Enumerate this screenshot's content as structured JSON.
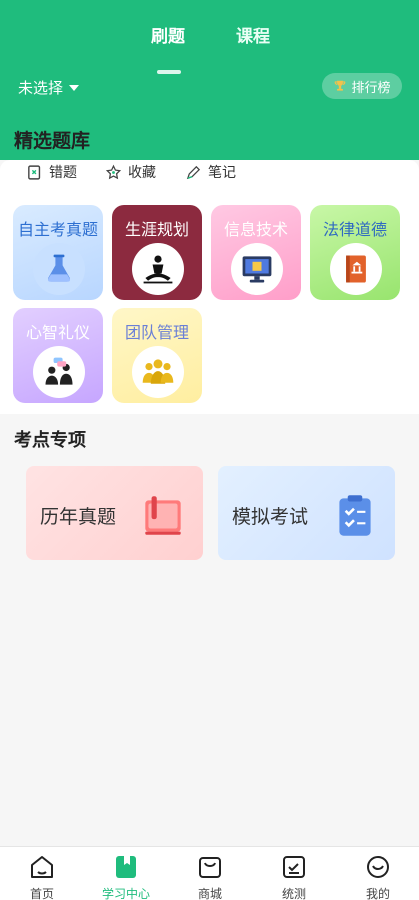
{
  "header": {
    "tabs": [
      {
        "label": "刷题",
        "active": true
      },
      {
        "label": "课程",
        "active": false
      }
    ],
    "selector_label": "未选择",
    "rank_button": "排行榜",
    "accent_color": "#1fbc7d"
  },
  "featured": {
    "title": "精选题库",
    "actions": [
      {
        "label": "错题",
        "icon": "wrong-book-icon"
      },
      {
        "label": "收藏",
        "icon": "star-icon"
      },
      {
        "label": "笔记",
        "icon": "pen-icon"
      }
    ],
    "cards": [
      {
        "label": "自主考真题",
        "icon": "flask-icon"
      },
      {
        "label": "生涯规划",
        "icon": "meditation-icon"
      },
      {
        "label": "信息技术",
        "icon": "monitor-icon"
      },
      {
        "label": "法律道德",
        "icon": "law-book-icon"
      },
      {
        "label": "心智礼仪",
        "icon": "people-chat-icon"
      },
      {
        "label": "团队管理",
        "icon": "team-icon"
      }
    ]
  },
  "topics": {
    "title": "考点专项",
    "items": [
      {
        "label": "历年真题",
        "icon": "book-flag-icon"
      },
      {
        "label": "模拟考试",
        "icon": "clipboard-check-icon"
      }
    ]
  },
  "bottom_nav": [
    {
      "label": "首页",
      "icon": "home-icon",
      "active": false
    },
    {
      "label": "学习中心",
      "icon": "bookmark-book-icon",
      "active": true
    },
    {
      "label": "商城",
      "icon": "shopping-bag-icon",
      "active": false
    },
    {
      "label": "统测",
      "icon": "checklist-icon",
      "active": false
    },
    {
      "label": "我的",
      "icon": "smile-icon",
      "active": false
    }
  ]
}
